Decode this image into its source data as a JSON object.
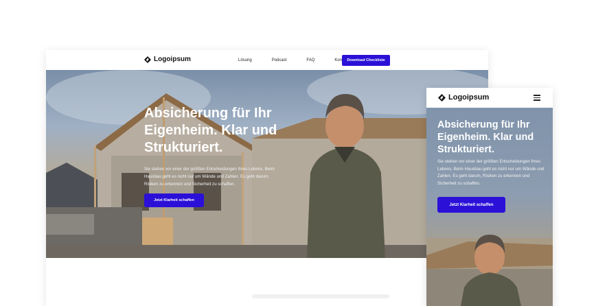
{
  "brand": {
    "name": "Logoipsum",
    "accent": "#2b10d8"
  },
  "desktop": {
    "nav": {
      "links": [
        "Lösung",
        "Podcast",
        "FAQ",
        "Kontakt"
      ],
      "cta": "Download Checkliste"
    },
    "hero": {
      "headline": "Absicherung für Ihr Eigenheim. Klar und Strukturiert.",
      "text": "Sie stehen vor einer der größten Entscheidungen Ihres Lebens. Beim Hausbau geht es nicht nur um Wände und Zahlen. Es geht darum, Risiken zu erkennen und Sicherheit zu schaffen.",
      "button": "Jetzt Klarheit schaffen"
    }
  },
  "mobile": {
    "menu_icon": "hamburger-icon",
    "hero": {
      "headline": "Absicherung für Ihr Eigenheim. Klar und Strukturiert.",
      "text": "Sie stehen vor einer der größten Entscheidungen Ihres Lebens. Beim Hausbau geht es nicht nur um Wände und Zahlen. Es geht darum, Risiken zu erkennen und Sicherheit zu schaffen.",
      "button": "Jetzt Klarheit schaffen"
    }
  }
}
